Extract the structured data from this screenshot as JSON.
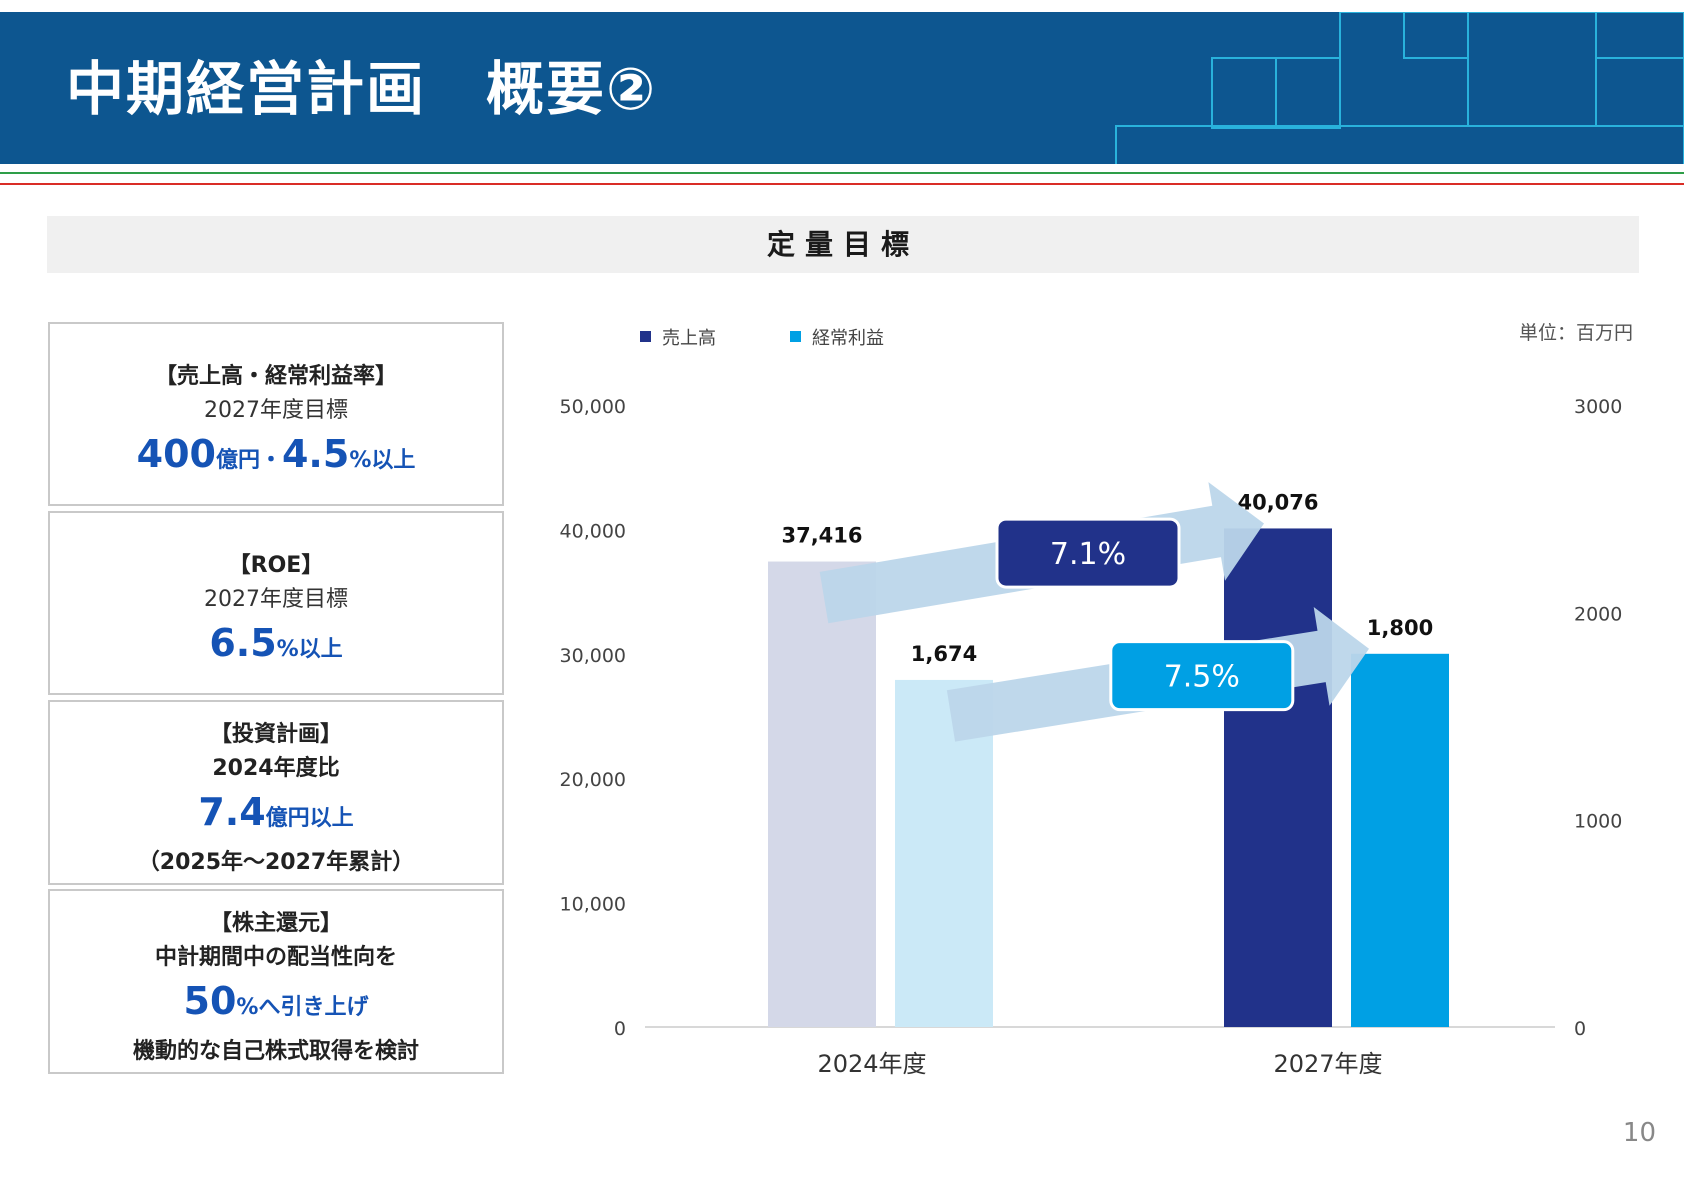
{
  "header": {
    "title": "中期経営計画　概要②"
  },
  "section": {
    "title": "定量目標"
  },
  "targets": [
    {
      "heading": "【売上高・経常利益率】",
      "subtitle": "2027年度目標",
      "value_1": "400",
      "unit_1": "億円・",
      "value_2": "4.5",
      "unit_2": "%以上"
    },
    {
      "heading": "【ROE】",
      "subtitle": "2027年度目標",
      "value": "6.5",
      "unit": "%以上"
    },
    {
      "heading": "【投資計画】",
      "subtitle": "2024年度比",
      "value": "7.4",
      "unit": "億円以上",
      "note": "（2025年～2027年累計）"
    },
    {
      "heading": "【株主還元】",
      "line_1": "中計期間中の配当性向を",
      "value": "50",
      "unit": "%へ引き上げ",
      "line_2": "機動的な自己株式取得を検討"
    }
  ],
  "chart_data": {
    "type": "bar",
    "unit_label": "単位：百万円",
    "categories": [
      "2024年度",
      "2027年度"
    ],
    "series": [
      {
        "name": "売上高",
        "axis": "left",
        "color": "#21328a",
        "values": [
          37416,
          40076
        ],
        "labels": [
          "37,416",
          "40,076"
        ],
        "bar_colors": [
          "#d4d8e8",
          "#21328a"
        ]
      },
      {
        "name": "経常利益",
        "axis": "right",
        "color": "#00a0e4",
        "values": [
          1674,
          1800
        ],
        "labels": [
          "1,674",
          "1,800"
        ],
        "bar_colors": [
          "#cbe9f7",
          "#00a0e4"
        ]
      }
    ],
    "y_left": {
      "min": 0,
      "max": 50000,
      "ticks": [
        "0",
        "10,000",
        "20,000",
        "30,000",
        "40,000",
        "50,000"
      ]
    },
    "y_right": {
      "min": 0,
      "max": 3000,
      "ticks": [
        "0",
        "1000",
        "2000",
        "3000"
      ]
    },
    "growth": [
      {
        "series": "売上高",
        "label": "7.1%",
        "color": "#21328a"
      },
      {
        "series": "経常利益",
        "label": "7.5%",
        "color": "#00a0e4"
      }
    ],
    "legend_position": "top-left",
    "grid": false
  },
  "page_number": "10"
}
